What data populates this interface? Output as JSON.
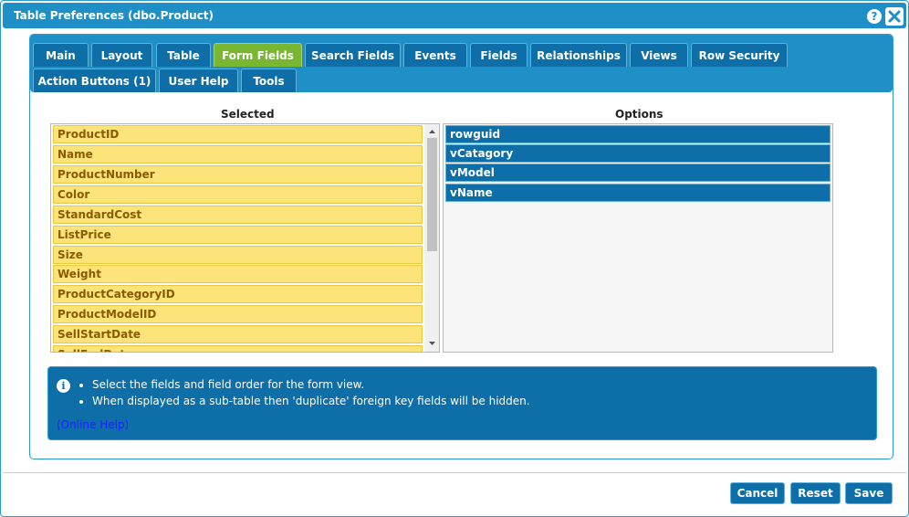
{
  "window": {
    "title": "Table Preferences (dbo.Product)"
  },
  "tabs": [
    {
      "label": "Main"
    },
    {
      "label": "Layout"
    },
    {
      "label": "Table"
    },
    {
      "label": "Form Fields"
    },
    {
      "label": "Search Fields"
    },
    {
      "label": "Events"
    },
    {
      "label": "Fields"
    },
    {
      "label": "Relationships"
    },
    {
      "label": "Views"
    },
    {
      "label": "Row Security"
    },
    {
      "label": "Action Buttons (1)"
    },
    {
      "label": "User Help"
    },
    {
      "label": "Tools"
    }
  ],
  "active_tab": "Form Fields",
  "selected": {
    "header": "Selected",
    "items": [
      "ProductID",
      "Name",
      "ProductNumber",
      "Color",
      "StandardCost",
      "ListPrice",
      "Size",
      "Weight",
      "ProductCategoryID",
      "ProductModelID",
      "SellStartDate",
      "SellEndDate"
    ]
  },
  "options": {
    "header": "Options",
    "items": [
      "rowguid",
      "vCatagory",
      "vModel",
      "vName"
    ]
  },
  "info": {
    "bullets": [
      "Select the fields and field order for the form view.",
      "When displayed as a sub-table then 'duplicate' foreign key fields will be hidden."
    ],
    "link": "(Online Help)"
  },
  "buttons": {
    "cancel": "Cancel",
    "reset": "Reset",
    "save": "Save"
  },
  "colors": {
    "title_bar": "#1f8fc7",
    "tab": "#0e6ea7",
    "active_tab": "#79b732",
    "selected_item": "#fde47a",
    "option_item": "#0e6ea7"
  }
}
